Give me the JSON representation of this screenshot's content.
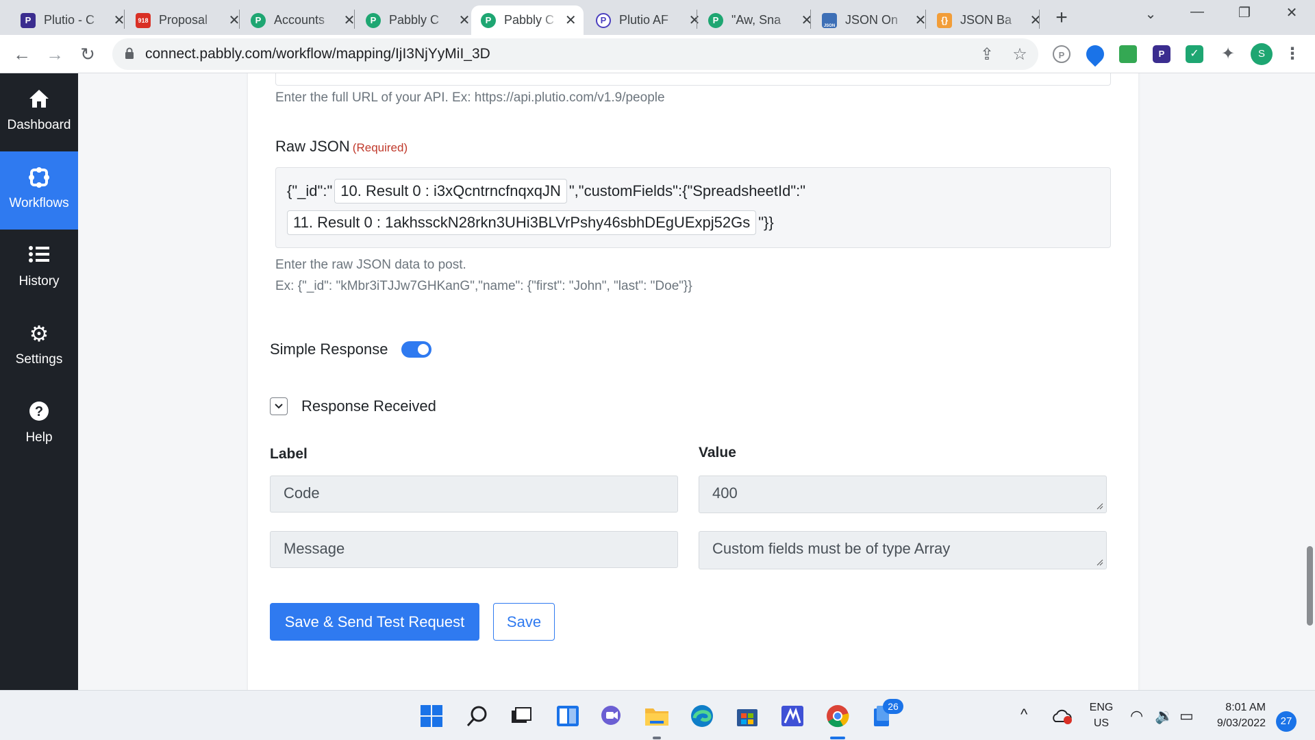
{
  "browser": {
    "tabs": [
      {
        "title": "Plutio - C",
        "favicon": "plutio-icon",
        "color": "#3b2d8f",
        "glyph": "P"
      },
      {
        "title": "Proposal",
        "favicon": "calendar-icon",
        "color": "#d93025",
        "glyph": "918"
      },
      {
        "title": "Accounts",
        "favicon": "pabbly-icon",
        "color": "#1ea672",
        "glyph": "P"
      },
      {
        "title": "Pabbly C",
        "favicon": "pabbly-icon",
        "color": "#1ea672",
        "glyph": "P"
      },
      {
        "title": "Pabbly C",
        "favicon": "pabbly-icon",
        "color": "#1ea672",
        "glyph": "P",
        "active": true
      },
      {
        "title": "Plutio AF",
        "favicon": "plutio-api-icon",
        "color": "#4b3fbf",
        "glyph": "P"
      },
      {
        "title": "\"Aw, Sna",
        "favicon": "pabbly-icon",
        "color": "#1ea672",
        "glyph": "P"
      },
      {
        "title": "JSON On",
        "favicon": "json-icon",
        "color": "#3d6fb6",
        "glyph": "JSON"
      },
      {
        "title": "JSON Ba",
        "favicon": "json-beautify-icon",
        "color": "#f29d38",
        "glyph": "{}"
      }
    ],
    "url": "connect.pabbly.com/workflow/mapping/IjI3NjYyMiI_3D"
  },
  "sidebar": {
    "items": [
      {
        "label": "Dashboard",
        "icon": "home-icon",
        "active": false
      },
      {
        "label": "Workflows",
        "icon": "workflow-icon",
        "active": true
      },
      {
        "label": "History",
        "icon": "list-icon",
        "active": false
      },
      {
        "label": "Settings",
        "icon": "gear-icon",
        "active": false
      },
      {
        "label": "Help",
        "icon": "help-icon",
        "active": false
      }
    ]
  },
  "form": {
    "url_help": "Enter the full URL of your API. Ex: https://api.plutio.com/v1.9/people",
    "raw_json": {
      "label": "Raw JSON",
      "required": "(Required)",
      "line1_prefix": "{\"_id\":\"",
      "chip1": "10. Result 0 : i3xQcntrncfnqxqJN",
      "line1_suffix": "\",\"customFields\":{\"SpreadsheetId\":\"",
      "chip2": "11. Result 0 : 1akhssckN28rkn3UHi3BLVrPshy46sbhDEgUExpj52Gs",
      "line2_suffix": "\"}}",
      "help_line1": "Enter the raw JSON data to post.",
      "help_line2": "Ex: {\"_id\": \"kMbr3iTJJw7GHKanG\",\"name\": {\"first\": \"John\", \"last\": \"Doe\"}}"
    },
    "simple_response": {
      "label": "Simple Response",
      "enabled": true
    },
    "response_received": {
      "label": "Response Received",
      "label_header": "Label",
      "value_header": "Value",
      "rows": [
        {
          "label": "Code",
          "value": "400"
        },
        {
          "label": "Message",
          "value": "Custom fields must be of type Array"
        }
      ]
    },
    "buttons": {
      "save_send": "Save & Send Test Request",
      "save": "Save"
    }
  },
  "taskbar": {
    "badge_count": "26",
    "lang_line1": "ENG",
    "lang_line2": "US",
    "time": "8:01 AM",
    "date": "9/03/2022",
    "notifications": "27"
  },
  "colors": {
    "accent": "#2f7af0",
    "sidebar": "#1e2228",
    "required": "#c0392b"
  }
}
